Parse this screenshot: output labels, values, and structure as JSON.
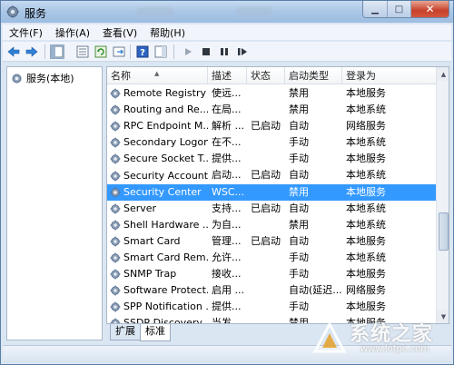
{
  "window": {
    "title": "服务",
    "close_glyph": "✕",
    "minimize_glyph": "▁",
    "maximize_glyph": "□"
  },
  "menu": [
    {
      "label": "文件(F)",
      "name": "menu-file"
    },
    {
      "label": "操作(A)",
      "name": "menu-action"
    },
    {
      "label": "查看(V)",
      "name": "menu-view"
    },
    {
      "label": "帮助(H)",
      "name": "menu-help"
    }
  ],
  "tree": {
    "root_label": "服务(本地)"
  },
  "table": {
    "columns": [
      "名称",
      "描述",
      "状态",
      "启动类型",
      "登录为"
    ],
    "rows": [
      {
        "name": "Remote Registry",
        "desc": "使远...",
        "status": "",
        "startup": "禁用",
        "login": "本地服务"
      },
      {
        "name": "Routing and Re...",
        "desc": "在局...",
        "status": "",
        "startup": "禁用",
        "login": "本地系统"
      },
      {
        "name": "RPC Endpoint M...",
        "desc": "解析 ...",
        "status": "已启动",
        "startup": "自动",
        "login": "网络服务"
      },
      {
        "name": "Secondary Logon",
        "desc": "在不...",
        "status": "",
        "startup": "手动",
        "login": "本地系统"
      },
      {
        "name": "Secure Socket T...",
        "desc": "提供...",
        "status": "",
        "startup": "手动",
        "login": "本地服务"
      },
      {
        "name": "Security Account...",
        "desc": "启动...",
        "status": "已启动",
        "startup": "自动",
        "login": "本地系统"
      },
      {
        "name": "Security Center",
        "desc": "WSC...",
        "status": "",
        "startup": "禁用",
        "login": "本地服务",
        "selected": true
      },
      {
        "name": "Server",
        "desc": "支持...",
        "status": "已启动",
        "startup": "自动",
        "login": "本地系统"
      },
      {
        "name": "Shell Hardware ...",
        "desc": "为自...",
        "status": "",
        "startup": "禁用",
        "login": "本地系统"
      },
      {
        "name": "Smart Card",
        "desc": "管理...",
        "status": "已启动",
        "startup": "自动",
        "login": "本地服务"
      },
      {
        "name": "Smart Card Rem...",
        "desc": "允许...",
        "status": "",
        "startup": "手动",
        "login": "本地系统"
      },
      {
        "name": "SNMP Trap",
        "desc": "接收...",
        "status": "",
        "startup": "手动",
        "login": "本地服务"
      },
      {
        "name": "Software Protect...",
        "desc": "启用 ...",
        "status": "",
        "startup": "自动(延迟...",
        "login": "网络服务"
      },
      {
        "name": "SPP Notification ...",
        "desc": "提供...",
        "status": "",
        "startup": "手动",
        "login": "本地服务"
      },
      {
        "name": "SSDP Discovery",
        "desc": "当发...",
        "status": "",
        "startup": "禁用",
        "login": "本地服务"
      }
    ]
  },
  "tabs": [
    {
      "label": "扩展",
      "active": false
    },
    {
      "label": "标准",
      "active": true
    }
  ],
  "watermark": {
    "text": "系统之家",
    "url": "www.lotpc.com"
  },
  "colors": {
    "selection": "#3399ff",
    "title_gradient_top": "#c6daf0",
    "close_button": "#c7402a"
  }
}
